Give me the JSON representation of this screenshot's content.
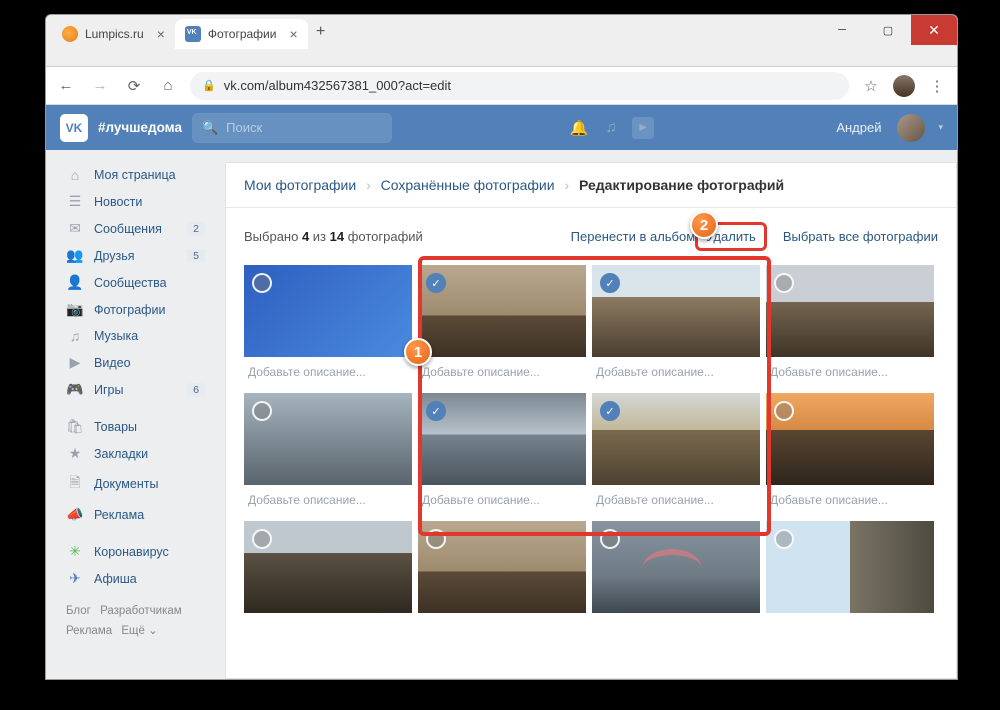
{
  "browser": {
    "tabs": [
      {
        "title": "Lumpics.ru",
        "active": false
      },
      {
        "title": "Фотографии",
        "active": true
      }
    ],
    "url": "vk.com/album432567381_000?act=edit"
  },
  "vkheader": {
    "hashtag": "#лучшедома",
    "search_placeholder": "Поиск",
    "username": "Андрей"
  },
  "sidebar": {
    "items": [
      {
        "icon": "⌂",
        "label": "Моя страница"
      },
      {
        "icon": "☰",
        "label": "Новости"
      },
      {
        "icon": "✉",
        "label": "Сообщения",
        "badge": "2"
      },
      {
        "icon": "👥",
        "label": "Друзья",
        "badge": "5"
      },
      {
        "icon": "👤",
        "label": "Сообщества"
      },
      {
        "icon": "📷",
        "label": "Фотографии"
      },
      {
        "icon": "♫",
        "label": "Музыка"
      },
      {
        "icon": "▶",
        "label": "Видео"
      },
      {
        "icon": "🎮",
        "label": "Игры",
        "badge": "6"
      }
    ],
    "items2": [
      {
        "icon": "🛍",
        "label": "Товары"
      },
      {
        "icon": "★",
        "label": "Закладки"
      },
      {
        "icon": "🗎",
        "label": "Документы"
      },
      {
        "icon": "📣",
        "label": "Реклама"
      }
    ],
    "items3": [
      {
        "icon": "✳",
        "label": "Коронавирус"
      },
      {
        "icon": "✈",
        "label": "Афиша"
      }
    ],
    "footer": {
      "blog": "Блог",
      "devs": "Разработчикам",
      "ads": "Реклама",
      "more": "Ещё ⌄"
    }
  },
  "breadcrumb": {
    "a": "Мои фотографии",
    "b": "Сохранённые фотографии",
    "c": "Редактирование фотографий"
  },
  "selectbar": {
    "prefix": "Выбрано ",
    "sel": "4",
    "mid": " из ",
    "total": "14",
    "suffix": " фотографий",
    "move": "Перенести в альбом",
    "delete": "Удалить",
    "select_all": "Выбрать все фотографии"
  },
  "caption_placeholder": "Добавьте описание...",
  "steps": {
    "one": "1",
    "two": "2"
  }
}
